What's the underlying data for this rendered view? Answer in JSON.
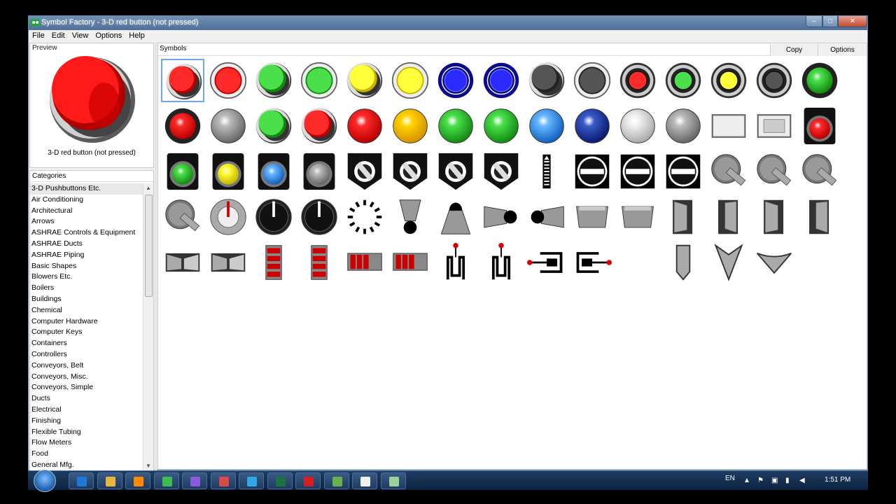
{
  "window": {
    "title": "Symbol Factory - 3-D red button (not pressed)",
    "minimize": "–",
    "maximize": "□",
    "close": "✕"
  },
  "menu": [
    "File",
    "Edit",
    "View",
    "Options",
    "Help"
  ],
  "preview": {
    "title": "Preview",
    "caption": "3-D red button (not pressed)"
  },
  "categories": {
    "title": "Categories",
    "items": [
      "3-D Pushbuttons Etc.",
      "Air Conditioning",
      "Architectural",
      "Arrows",
      "ASHRAE Controls & Equipment",
      "ASHRAE Ducts",
      "ASHRAE Piping",
      "Basic Shapes",
      "Blowers Etc.",
      "Boilers",
      "Buildings",
      "Chemical",
      "Computer Hardware",
      "Computer Keys",
      "Containers",
      "Controllers",
      "Conveyors, Belt",
      "Conveyors, Misc.",
      "Conveyors, Simple",
      "Ducts",
      "Electrical",
      "Finishing",
      "Flexible Tubing",
      "Flow Meters",
      "Food",
      "General Mfg."
    ]
  },
  "symbols": {
    "title": "Symbols",
    "copy": "Copy",
    "options": "Options"
  },
  "taskbar": {
    "lang": "EN",
    "time": "1:51 PM",
    "apps": [
      "ie-icon",
      "explorer-icon",
      "media-player-icon",
      "chrome-icon",
      "visual-studio-icon",
      "app-icon",
      "skype-icon",
      "excel-icon",
      "acrobat-icon",
      "camtasia-icon",
      "camtasia-recorder-icon",
      "symbol-factory-icon"
    ]
  },
  "colors": {
    "red": "#e01010",
    "green": "#2db82d",
    "yellow": "#f0e000",
    "blue": "#1515d0",
    "selection": "#6aa8e8"
  }
}
